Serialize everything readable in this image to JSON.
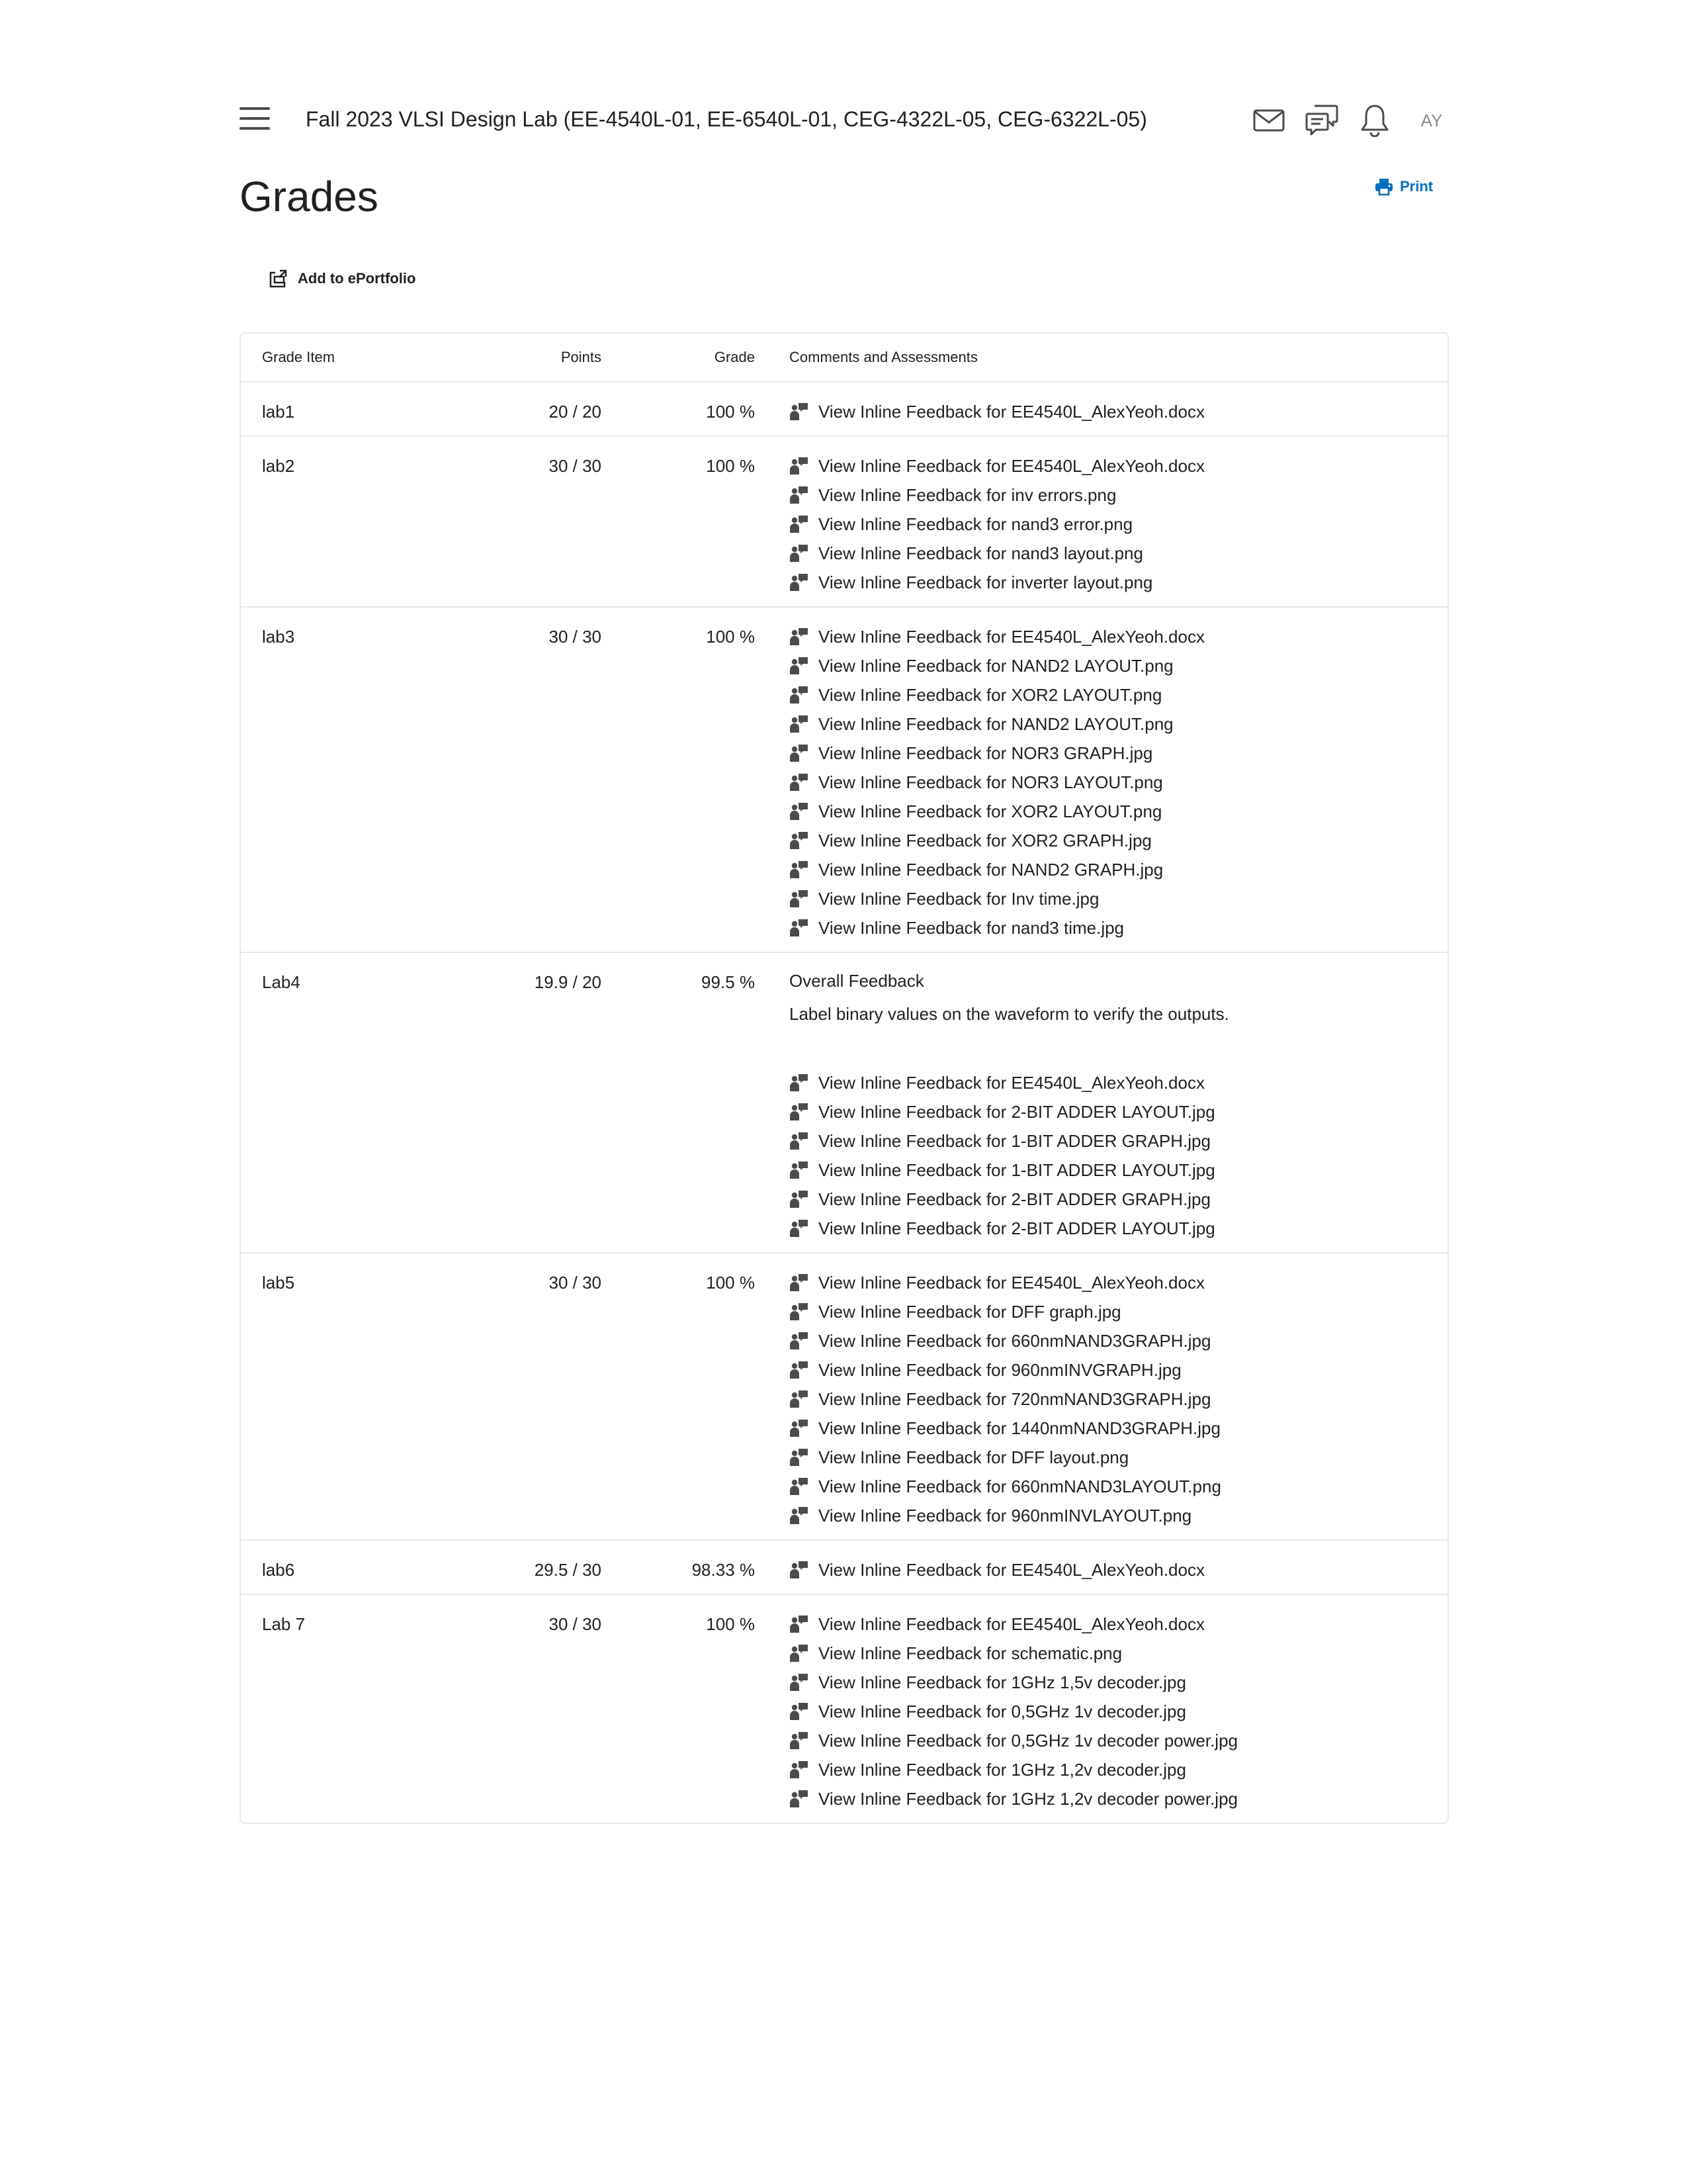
{
  "header": {
    "course_title": "Fall 2023 VLSI Design Lab (EE-4540L-01, EE-6540L-01, CEG-4322L-05, CEG-6322L-05)",
    "icons": [
      "menu-icon",
      "mail-icon",
      "chat-icon",
      "bell-icon"
    ],
    "avatar_initials": "AY"
  },
  "page": {
    "title": "Grades",
    "print_label": "Print",
    "eportfolio_label": "Add to ePortfolio"
  },
  "table": {
    "headers": {
      "grade_item": "Grade Item",
      "points": "Points",
      "grade": "Grade",
      "comments": "Comments and Assessments"
    },
    "rows": [
      {
        "item": "lab1",
        "points": "20 / 20",
        "grade": "100 %",
        "feedback": [
          "View Inline Feedback for EE4540L_AlexYeoh.docx"
        ]
      },
      {
        "item": "lab2",
        "points": "30 / 30",
        "grade": "100 %",
        "feedback": [
          "View Inline Feedback for EE4540L_AlexYeoh.docx",
          "View Inline Feedback for inv errors.png",
          "View Inline Feedback for nand3 error.png",
          "View Inline Feedback for nand3 layout.png",
          "View Inline Feedback for inverter layout.png"
        ]
      },
      {
        "item": "lab3",
        "points": "30 / 30",
        "grade": "100 %",
        "feedback": [
          "View Inline Feedback for EE4540L_AlexYeoh.docx",
          "View Inline Feedback for NAND2 LAYOUT.png",
          "View Inline Feedback for XOR2 LAYOUT.png",
          "View Inline Feedback for NAND2 LAYOUT.png",
          "View Inline Feedback for NOR3 GRAPH.jpg",
          "View Inline Feedback for NOR3 LAYOUT.png",
          "View Inline Feedback for XOR2 LAYOUT.png",
          "View Inline Feedback for XOR2 GRAPH.jpg",
          "View Inline Feedback for NAND2 GRAPH.jpg",
          "View Inline Feedback for Inv time.jpg",
          "View Inline Feedback for nand3 time.jpg"
        ]
      },
      {
        "item": "Lab4",
        "points": "19.9 / 20",
        "grade": "99.5 %",
        "overall_heading": "Overall Feedback",
        "overall_text": "Label binary values on the waveform to verify the outputs.",
        "feedback": [
          "View Inline Feedback for EE4540L_AlexYeoh.docx",
          "View Inline Feedback for 2-BIT ADDER LAYOUT.jpg",
          "View Inline Feedback for 1-BIT ADDER GRAPH.jpg",
          "View Inline Feedback for 1-BIT ADDER LAYOUT.jpg",
          "View Inline Feedback for 2-BIT ADDER GRAPH.jpg",
          "View Inline Feedback for 2-BIT ADDER LAYOUT.jpg"
        ]
      },
      {
        "item": "lab5",
        "points": "30 / 30",
        "grade": "100 %",
        "feedback": [
          "View Inline Feedback for EE4540L_AlexYeoh.docx",
          "View Inline Feedback for DFF graph.jpg",
          "View Inline Feedback for 660nmNAND3GRAPH.jpg",
          "View Inline Feedback for 960nmINVGRAPH.jpg",
          "View Inline Feedback for 720nmNAND3GRAPH.jpg",
          "View Inline Feedback for 1440nmNAND3GRAPH.jpg",
          "View Inline Feedback for DFF layout.png",
          "View Inline Feedback for 660nmNAND3LAYOUT.png",
          "View Inline Feedback for 960nmINVLAYOUT.png"
        ]
      },
      {
        "item": "lab6",
        "points": "29.5 / 30",
        "grade": "98.33 %",
        "feedback": [
          "View Inline Feedback for EE4540L_AlexYeoh.docx"
        ]
      },
      {
        "item": "Lab 7",
        "points": "30 / 30",
        "grade": "100 %",
        "feedback": [
          "View Inline Feedback for EE4540L_AlexYeoh.docx",
          "View Inline Feedback for schematic.png",
          "View Inline Feedback for 1GHz 1,5v decoder.jpg",
          "View Inline Feedback for 0,5GHz 1v decoder.jpg",
          "View Inline Feedback for 0,5GHz 1v decoder power.jpg",
          "View Inline Feedback for 1GHz 1,2v decoder.jpg",
          "View Inline Feedback for 1GHz 1,2v decoder power.jpg"
        ]
      }
    ]
  },
  "colors": {
    "text": "#202122",
    "link_blue": "#006fbf",
    "border": "#e3e9f1",
    "icon_gray": "#494c4e",
    "avatar_gray": "#8a8c8e"
  }
}
